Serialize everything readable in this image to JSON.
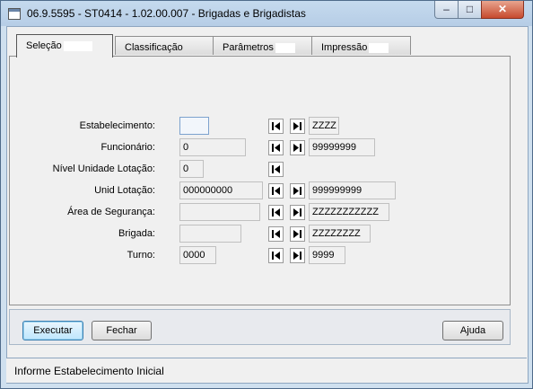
{
  "window": {
    "title": "06.9.5595 - ST0414 - 1.02.00.007 - Brigadas e Brigadistas",
    "minimize_glyph": "–",
    "maximize_glyph": "□",
    "close_glyph": "✕"
  },
  "tabs": [
    {
      "label": "Seleção",
      "active": true
    },
    {
      "label": "Classificação",
      "active": false
    },
    {
      "label": "Parâmetros",
      "active": false
    },
    {
      "label": "Impressão",
      "active": false
    }
  ],
  "form": {
    "estabelecimento": {
      "label": "Estabelecimento:",
      "from": "",
      "to": "ZZZZ"
    },
    "funcionario": {
      "label": "Funcionário:",
      "from": "0",
      "to": "99999999"
    },
    "nivel_unidade": {
      "label": "Nível Unidade Lotação:",
      "from": "0"
    },
    "unid_lotacao": {
      "label": "Unid Lotação:",
      "from": "000000000",
      "to": "999999999"
    },
    "area_seguranca": {
      "label": "Área de Segurança:",
      "from": "",
      "to": "ZZZZZZZZZZZ"
    },
    "brigada": {
      "label": "Brigada:",
      "from": "",
      "to": "ZZZZZZZZ"
    },
    "turno": {
      "label": "Turno:",
      "from": "0000",
      "to": "9999"
    }
  },
  "buttons": {
    "executar": "Executar",
    "fechar": "Fechar",
    "ajuda": "Ajuda"
  },
  "status": "Informe Estabelecimento Inicial",
  "icons": {
    "first": "first-record-icon",
    "last": "last-record-icon"
  }
}
